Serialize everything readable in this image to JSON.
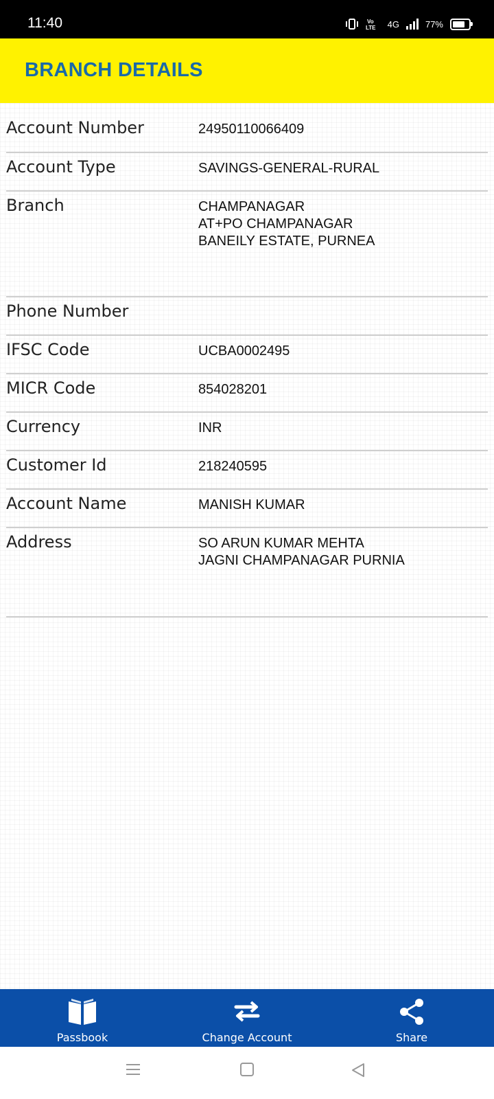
{
  "status_bar": {
    "time": "11:40",
    "network": "4G",
    "battery_text": "77%",
    "battery_level": 0.77
  },
  "header": {
    "title": "BRANCH DETAILS"
  },
  "details": [
    {
      "label": "Account Number",
      "value": [
        "24950110066409"
      ]
    },
    {
      "label": "Account Type",
      "value": [
        "SAVINGS-GENERAL-RURAL"
      ]
    },
    {
      "label": "Branch",
      "value": [
        "CHAMPANAGAR",
        "AT+PO CHAMPANAGAR",
        "BANEILY ESTATE, PURNEA"
      ]
    },
    {
      "label": "Phone Number",
      "value": []
    },
    {
      "label": "IFSC Code",
      "value": [
        "UCBA0002495"
      ]
    },
    {
      "label": "MICR Code",
      "value": [
        "854028201"
      ]
    },
    {
      "label": "Currency",
      "value": [
        "INR"
      ]
    },
    {
      "label": "Customer Id",
      "value": [
        "218240595"
      ]
    },
    {
      "label": "Account Name",
      "value": [
        "MANISH KUMAR"
      ]
    },
    {
      "label": "Address",
      "value": [
        "SO ARUN KUMAR MEHTA",
        "JAGNI CHAMPANAGAR PURNIA"
      ]
    }
  ],
  "bottom_nav": [
    {
      "label": "Passbook",
      "icon": "book-icon"
    },
    {
      "label": "Change Account",
      "icon": "swap-arrows-icon"
    },
    {
      "label": "Share",
      "icon": "share-icon"
    }
  ],
  "colors": {
    "header_bg": "#fff200",
    "title": "#1a6aa8",
    "nav_bg": "#0b4fa8"
  }
}
